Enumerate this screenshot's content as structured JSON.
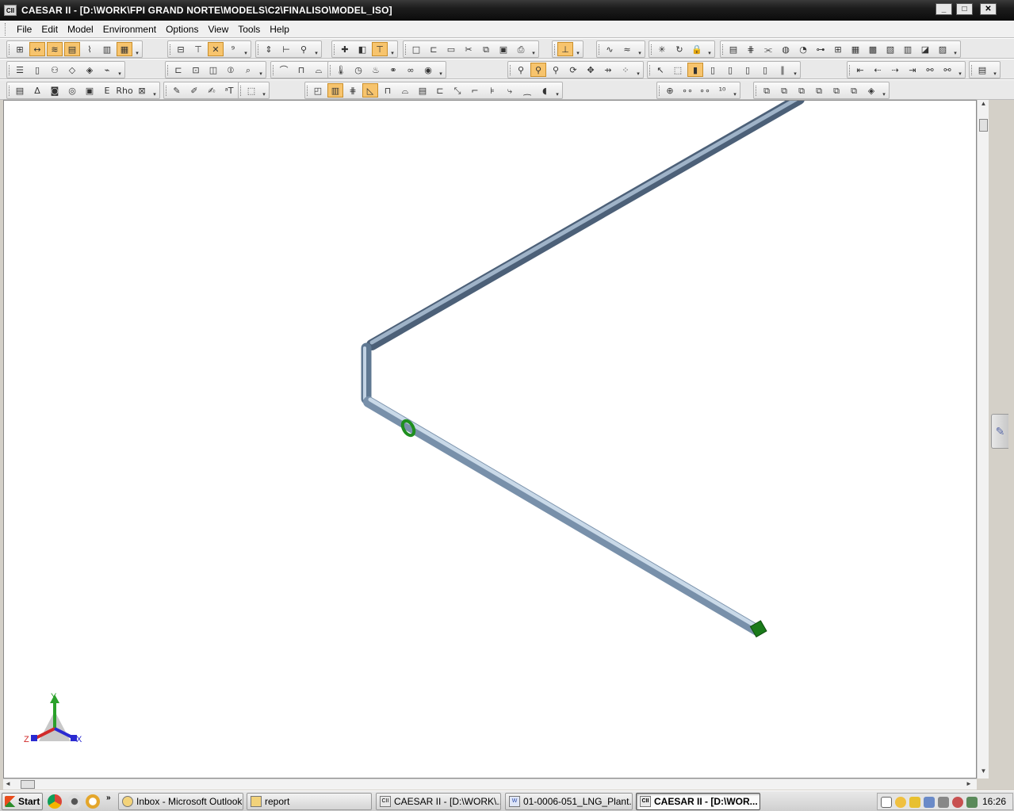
{
  "window": {
    "title": "CAESAR II - [D:\\WORK\\FPI GRAND NORTE\\MODELS\\C2\\FINALISO\\MODEL_ISO]",
    "app_icon_text": "CII",
    "minimize_label": "_",
    "maximize_label": "□",
    "close_label": "✕"
  },
  "menu": {
    "items": [
      {
        "label": "File"
      },
      {
        "label": "Edit"
      },
      {
        "label": "Model"
      },
      {
        "label": "Environment"
      },
      {
        "label": "Options"
      },
      {
        "label": "View"
      },
      {
        "label": "Tools"
      },
      {
        "label": "Help"
      }
    ]
  },
  "toolbars": {
    "row1": [
      {
        "icons": [
          "grid-icon",
          "dimension-icon",
          "offset-icon",
          "element-list-icon",
          "hatch-icon",
          "column-icon",
          "column-active-icon"
        ],
        "glyphs": [
          "⊞",
          "↔",
          "≋",
          "▤",
          "⌇",
          "▥",
          "▦"
        ]
      },
      {
        "icons": [
          "graphics-icon",
          "anchor-icon",
          "cross-icon",
          "node-numbers-icon"
        ],
        "glyphs": [
          "⊟",
          "⊤",
          "✕",
          "⁹"
        ]
      },
      {
        "icons": [
          "level-icon",
          "align-icon",
          "binoculars-icon"
        ],
        "glyphs": [
          "⇕",
          "⊢",
          "⚲"
        ]
      },
      {
        "icons": [
          "restraint-icon",
          "cube-icon",
          "hanger-icon"
        ],
        "glyphs": [
          "✚",
          "◧",
          "⊤"
        ]
      },
      {
        "icons": [
          "new-icon",
          "open-icon",
          "save-icon",
          "cut-icon",
          "copy-icon",
          "paste-icon",
          "print-icon"
        ],
        "glyphs": [
          "□",
          "⊏",
          "▭",
          "✂",
          "⧉",
          "▣",
          "⎙"
        ]
      },
      {
        "icons": [
          "tee-icon"
        ],
        "glyphs": [
          "⊥"
        ]
      },
      {
        "icons": [
          "signal-icon",
          "curve-icon"
        ],
        "glyphs": [
          "∿",
          "≈"
        ]
      },
      {
        "icons": [
          "star-icon",
          "refresh-icon",
          "lock-icon"
        ],
        "glyphs": [
          "✳",
          "↻",
          "🔒"
        ]
      },
      {
        "icons": [
          "report-icon",
          "nodes-icon",
          "break-icon",
          "valve-icon",
          "flange-icon",
          "sif-icon",
          "bend-icon",
          "rigid-icon",
          "expansion-icon",
          "reducer-icon",
          "wind-icon",
          "hydro-icon",
          "seismic-icon"
        ],
        "glyphs": [
          "▤",
          "⋕",
          "⫘",
          "◍",
          "◔",
          "⊶",
          "⊞",
          "▦",
          "▩",
          "▧",
          "▥",
          "◪",
          "▨"
        ]
      }
    ],
    "row2": [
      {
        "icons": [
          "list-icon",
          "document-icon",
          "person-icon",
          "paint-icon",
          "fill-icon",
          "eraser-icon"
        ],
        "glyphs": [
          "☰",
          "▯",
          "⚇",
          "◇",
          "◈",
          "⌁"
        ]
      },
      {
        "icons": [
          "support-icon",
          "display-icon",
          "pipe-icon",
          "flow-icon",
          "screw-icon"
        ],
        "glyphs": [
          "⊏",
          "⊡",
          "◫",
          "⦶",
          "⌕"
        ]
      },
      {
        "icons": [
          "bridge-icon",
          "table-icon",
          "truss-icon"
        ],
        "glyphs": [
          "⌒",
          "⊓",
          "⌓"
        ]
      },
      {
        "icons": [
          "thermometer-icon",
          "gauge-icon",
          "fire-icon",
          "chain-icon",
          "link-icon",
          "camera-icon"
        ],
        "glyphs": [
          "🌡",
          "◷",
          "♨",
          "⚭",
          "∞",
          "◉"
        ]
      },
      {
        "icons": [
          "zoom-window-icon",
          "zoom-extents-icon",
          "zoom-icon",
          "rotate-icon",
          "pan-icon",
          "walk-icon",
          "footprints-icon"
        ],
        "glyphs": [
          "⚲",
          "⚲",
          "⚲",
          "⟳",
          "✥",
          "⇸",
          "⁘"
        ]
      },
      {
        "icons": [
          "select-icon",
          "select-box-icon",
          "solid-icon",
          "wireframe-icon",
          "hidden-icon",
          "translucent-icon",
          "cylinder-icon",
          "centerline-icon"
        ],
        "glyphs": [
          "↖",
          "⬚",
          "▮",
          "▯",
          "▯",
          "▯",
          "▯",
          "∥"
        ]
      },
      {
        "icons": [
          "first-icon",
          "previous-icon",
          "next-icon",
          "last-icon",
          "chain-nodes-icon",
          "walkthrough-icon"
        ],
        "glyphs": [
          "⇤",
          "⇠",
          "⇢",
          "⇥",
          "⚯",
          "⚯"
        ]
      },
      {
        "icons": [
          "layers-icon"
        ],
        "glyphs": [
          "▤"
        ]
      }
    ],
    "row3": [
      {
        "icons": [
          "stress-icon",
          "delta-icon",
          "temperature-icon",
          "pressure-icon",
          "weight-icon",
          "elastic-icon",
          "density-icon",
          "insulation-icon"
        ],
        "glyphs": [
          "▤",
          "Δ",
          "◙",
          "◎",
          "▣",
          "E",
          "Rho",
          "⊠"
        ]
      },
      {
        "icons": [
          "pencil-icon",
          "edit-icon",
          "draw-icon",
          "text-icon"
        ],
        "glyphs": [
          "✎",
          "✐",
          "✍",
          "ᵃT"
        ]
      },
      {
        "icons": [
          "inspect-icon"
        ],
        "glyphs": [
          "⬚"
        ]
      },
      {
        "icons": [
          "bend-view-icon",
          "book-icon",
          "grid-view-icon",
          "plane-icon",
          "tee-view-icon",
          "pipe-view-icon",
          "equipment-icon",
          "tank-icon",
          "axis-icon",
          "elbow-icon",
          "stack-icon",
          "hook-icon",
          "bar-icon",
          "flex-icon"
        ],
        "glyphs": [
          "◰",
          "▥",
          "⋕",
          "◺",
          "⊓",
          "⌓",
          "▤",
          "⊏",
          "⤡",
          "⌐",
          "⊧",
          "⤷",
          "⁔",
          "◖"
        ]
      },
      {
        "icons": [
          "restraint-view-icon",
          "coords-icon",
          "offsets-icon",
          "node-range-icon"
        ],
        "glyphs": [
          "⊕",
          "∘∘",
          "∘∘",
          "¹⁰"
        ]
      },
      {
        "icons": [
          "box-front-icon",
          "box-back-icon",
          "box-left-icon",
          "box-right-icon",
          "box-top-icon",
          "box-bottom-icon",
          "view-iso-icon"
        ],
        "glyphs": [
          "⧉",
          "⧉",
          "⧉",
          "⧉",
          "⧉",
          "⧉",
          "◈"
        ]
      }
    ]
  },
  "model": {
    "pipe_color": "#6f8aa6",
    "pipe_highlight": "#c4d6e8",
    "restraint_color": "#1f8f1f",
    "anchor_color": "#1a7a1a",
    "axis_labels": {
      "y": "Y",
      "z": "Z",
      "x": "X"
    },
    "axis_colors": {
      "y": "#2aa12a",
      "z": "#d12a2a",
      "x": "#2a2ad1"
    }
  },
  "scrollbar": {
    "up": "▲",
    "down": "▼",
    "left": "◄",
    "right": "►"
  },
  "side_panel": {
    "icon": "pencil-icon",
    "glyph": "✎"
  },
  "taskbar": {
    "start_label": "Start",
    "overflow": "»",
    "buttons": [
      {
        "label": "Inbox - Microsoft Outlook",
        "icon": "outlook-icon",
        "active": false
      },
      {
        "label": "report",
        "icon": "folder-icon",
        "active": false
      },
      {
        "label": "CAESAR II - [D:\\WORK\\...",
        "icon": "caesar-icon",
        "active": false
      },
      {
        "label": "01-0006-051_LNG_Plant...",
        "icon": "word-icon",
        "active": false
      },
      {
        "label": "CAESAR II - [D:\\WOR...",
        "icon": "caesar-icon",
        "active": true
      }
    ],
    "clock": "16:26"
  }
}
